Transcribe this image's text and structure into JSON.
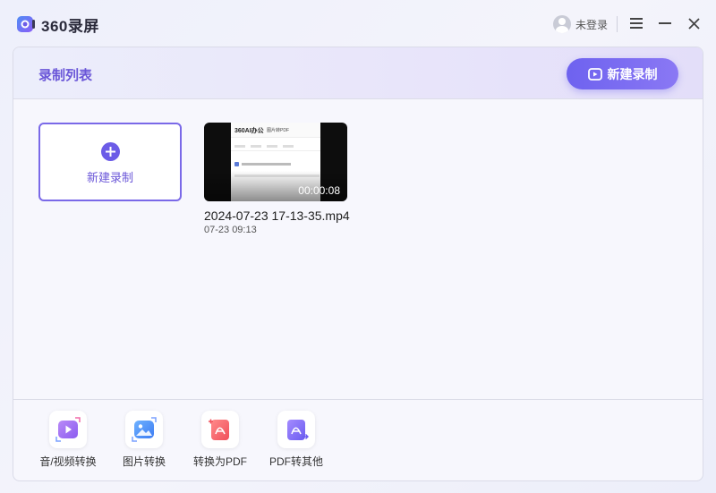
{
  "app": {
    "title": "360录屏",
    "user_label": "未登录"
  },
  "colors": {
    "accent": "#6c5ce7",
    "accent_text": "#6a56d8"
  },
  "section": {
    "title": "录制列表",
    "new_record_button": "新建录制"
  },
  "new_card": {
    "label": "新建录制"
  },
  "videos": [
    {
      "duration": "00:00:08",
      "name": "2024-07-23 17-13-35.mp4",
      "date": "07-23 09:13",
      "thumb_logo": "360AI办公",
      "thumb_subtitle": "图片转PDF"
    }
  ],
  "tools": [
    {
      "label": "音/视频转换",
      "icon": "media-convert-icon"
    },
    {
      "label": "图片转换",
      "icon": "image-convert-icon"
    },
    {
      "label": "转换为PDF",
      "icon": "to-pdf-icon"
    },
    {
      "label": "PDF转其他",
      "icon": "pdf-to-other-icon"
    }
  ]
}
